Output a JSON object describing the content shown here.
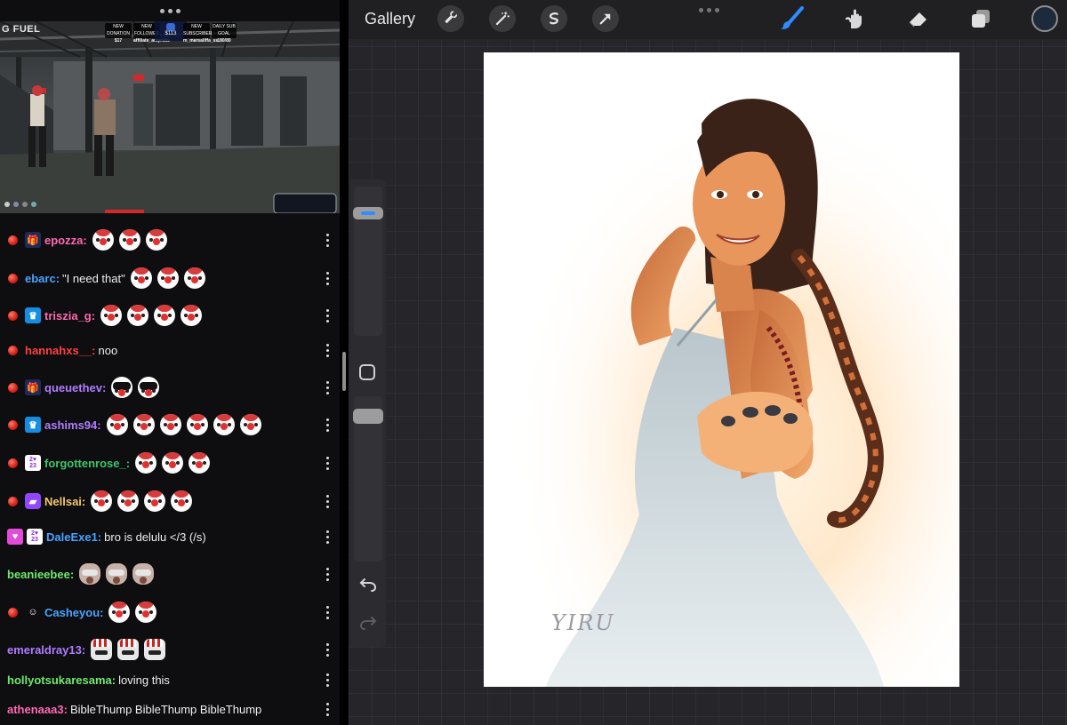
{
  "stream": {
    "brand": "G FUEL",
    "hud": [
      {
        "label": "NEW DONATION",
        "value": "$17"
      },
      {
        "label": "NEW FOLLOWER",
        "value": "affiliate_amyrstis"
      },
      {
        "label": "",
        "value": "$113"
      },
      {
        "label": "NEW SUBSCRIBER",
        "value": "m_marsaliffa_ss"
      },
      {
        "label": "DAILY SUB GOAL",
        "value": "180/80"
      }
    ]
  },
  "chat": {
    "messages": [
      {
        "user": "epozza",
        "color": "#ff69b4",
        "pred": true,
        "badges": [
          "gift"
        ],
        "text": "",
        "emotes": [
          "clown",
          "clown",
          "clown"
        ]
      },
      {
        "user": "ebarc",
        "color": "#4aa3ff",
        "pred": true,
        "badges": [],
        "text": "\"I need that\"",
        "emotes": [
          "clown",
          "clown",
          "clown"
        ]
      },
      {
        "user": "triszia_g",
        "color": "#ff69b4",
        "pred": true,
        "badges": [
          "crown"
        ],
        "text": "",
        "emotes": [
          "clown",
          "clown",
          "clown",
          "clown"
        ]
      },
      {
        "user": "hannahxs__",
        "color": "#ff4040",
        "pred": true,
        "badges": [],
        "text": "noo",
        "emotes": []
      },
      {
        "user": "queuethev",
        "color": "#b07cff",
        "pred": true,
        "badges": [
          "gift"
        ],
        "text": "",
        "emotes": [
          "sun",
          "sun"
        ]
      },
      {
        "user": "ashims94",
        "color": "#b07cff",
        "pred": true,
        "badges": [
          "crown"
        ],
        "text": "",
        "emotes": [
          "clown",
          "clown",
          "clown",
          "clown",
          "clown",
          "clown"
        ]
      },
      {
        "user": "forgottenrose_",
        "color": "#3ec46d",
        "pred": true,
        "badges": [
          "yr"
        ],
        "text": "",
        "emotes": [
          "clown",
          "clown",
          "clown"
        ]
      },
      {
        "user": "Nellsai",
        "color": "#f5c66b",
        "pred": true,
        "badges": [
          "purple"
        ],
        "text": "",
        "emotes": [
          "clown",
          "clown",
          "clown",
          "clown"
        ]
      },
      {
        "user": "DaleExe1",
        "color": "#4aa3ff",
        "pred": false,
        "badges": [
          "heart",
          "yr"
        ],
        "text": "bro is delulu </3 (/s)",
        "emotes": []
      },
      {
        "user": "beanieebee",
        "color": "#6fe86f",
        "pred": false,
        "badges": [],
        "text": "",
        "emotes": [
          "rat",
          "rat",
          "rat"
        ]
      },
      {
        "user": "Casheyou",
        "color": "#4aa3ff",
        "pred": true,
        "badges": [
          "face"
        ],
        "text": "",
        "emotes": [
          "clown",
          "clown"
        ]
      },
      {
        "user": "emeraldray13",
        "color": "#b07cff",
        "pred": false,
        "badges": [],
        "text": "",
        "emotes": [
          "cap",
          "cap",
          "cap"
        ]
      },
      {
        "user": "hollyotsukaresama",
        "color": "#6fe86f",
        "pred": false,
        "badges": [],
        "text": "loving this",
        "emotes": []
      },
      {
        "user": "athenaaa3",
        "color": "#ff69b4",
        "pred": false,
        "badges": [],
        "text": "BibleThump BibleThump BibleThump",
        "emotes": []
      }
    ]
  },
  "procreate": {
    "gallery_label": "Gallery",
    "tools": [
      "wrench-icon",
      "magic-wand-icon",
      "selection-icon",
      "transform-icon"
    ],
    "right_tools": [
      "brush-icon",
      "smudge-icon",
      "eraser-icon",
      "layers-icon"
    ],
    "brush_size": 0.85,
    "opacity": 1.0,
    "accent_color": "#2f8cff",
    "current_color": "#1d2a3c"
  },
  "artwork": {
    "signature": "YIRU"
  }
}
